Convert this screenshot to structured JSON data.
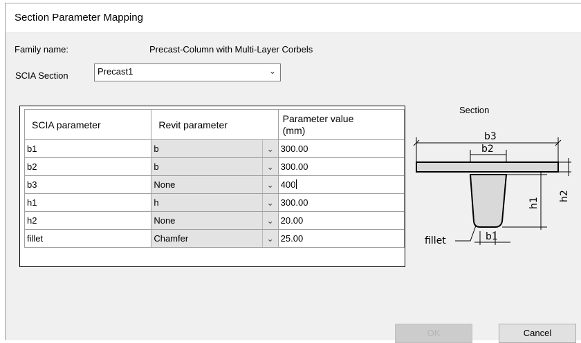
{
  "window": {
    "title": "Section Parameter Mapping"
  },
  "family": {
    "label": "Family name:",
    "value": "Precast-Column with Multi-Layer Corbels"
  },
  "section_select": {
    "label": "SCIA Section",
    "value": "Precast1",
    "icon": "chevron-down-icon"
  },
  "table": {
    "headers": [
      "SCIA parameter",
      "Revit parameter",
      "Parameter value\n(mm)"
    ],
    "rows": [
      {
        "scia": "b1",
        "revit": "b",
        "value": "300.00"
      },
      {
        "scia": "b2",
        "revit": "b",
        "value": "300.00"
      },
      {
        "scia": "b3",
        "revit": "None",
        "value": "400"
      },
      {
        "scia": "h1",
        "revit": "h",
        "value": "300.00"
      },
      {
        "scia": "h2",
        "revit": "None",
        "value": "20.00"
      },
      {
        "scia": "fillet",
        "revit": "Chamfer",
        "value": "25.00"
      }
    ]
  },
  "section_preview": {
    "title": "Section",
    "labels": {
      "b3": "b3",
      "b2": "b2",
      "b1": "b1",
      "h1": "h1",
      "h2": "h2",
      "fillet": "fillet"
    }
  },
  "buttons": {
    "ok": "OK",
    "cancel": "Cancel"
  }
}
